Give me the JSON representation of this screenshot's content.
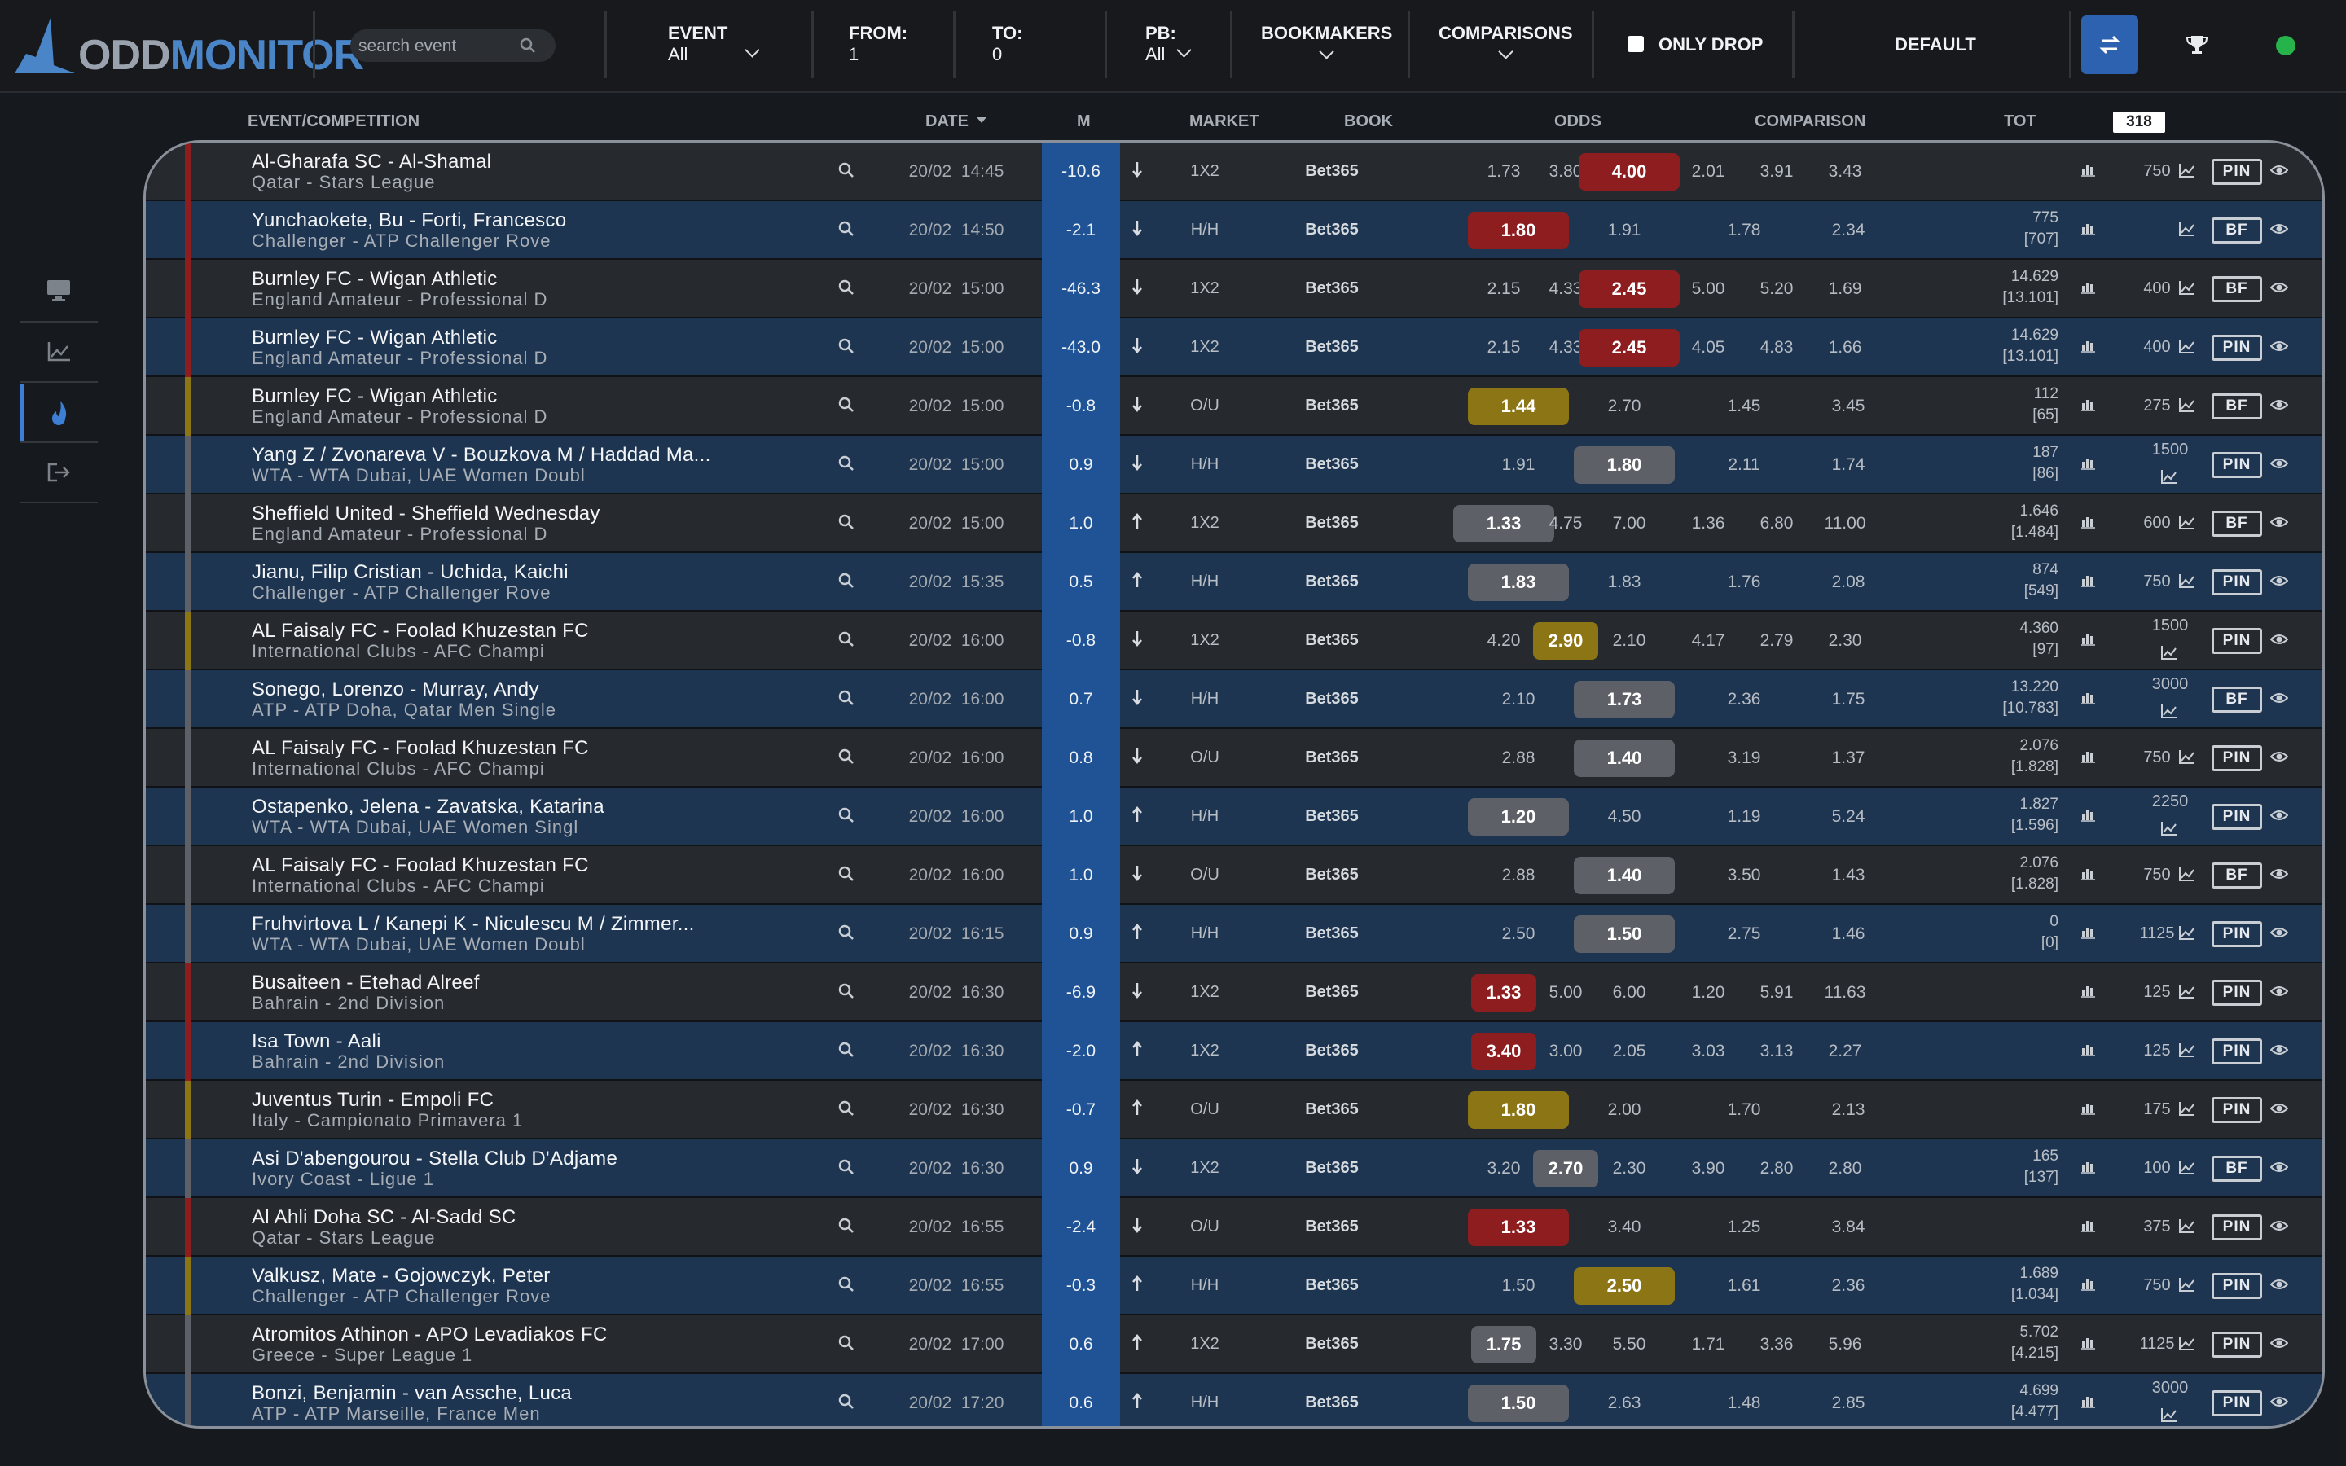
{
  "app": {
    "logo_odd": "ODD",
    "logo_monitor": "MONITOR",
    "search_placeholder": "search event"
  },
  "filters": {
    "event_label": "EVENT",
    "event_value": "All",
    "from_label": "FROM:",
    "from_value": "1",
    "to_label": "TO:",
    "to_value": "0",
    "pb_label": "PB:",
    "pb_value": "All",
    "bookmakers_label": "BOOKMAKERS",
    "comparisons_label": "COMPARISONS",
    "only_drop_label": "ONLY DROP",
    "default_label": "DEFAULT"
  },
  "colors": {
    "accent": "#2d62b0",
    "red": "#8e1d1f",
    "yellow": "#8c7514",
    "gray": "#5d6066",
    "status": "#27b34b"
  },
  "columns": {
    "event": "EVENT/COMPETITION",
    "date": "DATE",
    "m": "M",
    "market": "MARKET",
    "book": "BOOK",
    "odds": "ODDS",
    "comparison": "COMPARISON",
    "tot": "TOT",
    "count": "318"
  },
  "rows": [
    {
      "stripe": "red",
      "event": "Al-Gharafa SC - Al-Shamal",
      "comp": "Qatar - Stars League",
      "date": "20/02",
      "time": "14:45",
      "m": "-10.6",
      "dir": "down",
      "market": "1X2",
      "book": "Bet365",
      "odds": [
        "1.73",
        "3.80",
        "4.00"
      ],
      "hi": 2,
      "hic": "red",
      "cmp": [
        "2.01",
        "3.91",
        "3.43"
      ],
      "tot1": "",
      "tot2": "",
      "vol": "750",
      "tag": "PIN"
    },
    {
      "stripe": "red",
      "event": "Yunchaokete, Bu - Forti, Francesco",
      "comp": "Challenger - ATP Challenger Rove",
      "date": "20/02",
      "time": "14:50",
      "m": "-2.1",
      "dir": "down",
      "market": "H/H",
      "book": "Bet365",
      "odds": [
        "1.80",
        "1.91"
      ],
      "hi": 0,
      "hic": "red",
      "cmp": [
        "1.78",
        "2.34"
      ],
      "tot1": "775",
      "tot2": "[707]",
      "vol": "",
      "tag": "BF"
    },
    {
      "stripe": "red",
      "event": "Burnley FC - Wigan Athletic",
      "comp": "England Amateur - Professional D",
      "date": "20/02",
      "time": "15:00",
      "m": "-46.3",
      "dir": "down",
      "market": "1X2",
      "book": "Bet365",
      "odds": [
        "2.15",
        "4.33",
        "2.45"
      ],
      "hi": 2,
      "hic": "red",
      "cmp": [
        "5.00",
        "5.20",
        "1.69"
      ],
      "tot1": "14.629",
      "tot2": "[13.101]",
      "vol": "400",
      "tag": "BF"
    },
    {
      "stripe": "red",
      "event": "Burnley FC - Wigan Athletic",
      "comp": "England Amateur - Professional D",
      "date": "20/02",
      "time": "15:00",
      "m": "-43.0",
      "dir": "down",
      "market": "1X2",
      "book": "Bet365",
      "odds": [
        "2.15",
        "4.33",
        "2.45"
      ],
      "hi": 2,
      "hic": "red",
      "cmp": [
        "4.05",
        "4.83",
        "1.66"
      ],
      "tot1": "14.629",
      "tot2": "[13.101]",
      "vol": "400",
      "tag": "PIN"
    },
    {
      "stripe": "yellow",
      "event": "Burnley FC - Wigan Athletic",
      "comp": "England Amateur - Professional D",
      "date": "20/02",
      "time": "15:00",
      "m": "-0.8",
      "dir": "down",
      "market": "O/U",
      "book": "Bet365",
      "odds": [
        "1.44",
        "2.70"
      ],
      "hi": 0,
      "hic": "yellow",
      "cmp": [
        "1.45",
        "3.45"
      ],
      "tot1": "112",
      "tot2": "[65]",
      "vol": "275",
      "tag": "BF"
    },
    {
      "stripe": "gray",
      "event": "Yang Z / Zvonareva V - Bouzkova M / Haddad Ma...",
      "comp": "WTA - WTA Dubai, UAE Women Doubl",
      "date": "20/02",
      "time": "15:00",
      "m": "0.9",
      "dir": "down",
      "market": "H/H",
      "book": "Bet365",
      "odds": [
        "1.91",
        "1.80"
      ],
      "hi": 1,
      "hic": "gray",
      "cmp": [
        "2.11",
        "1.74"
      ],
      "tot1": "187",
      "tot2": "[86]",
      "vol": "1500",
      "stack": true,
      "tag": "PIN"
    },
    {
      "stripe": "gray",
      "event": "Sheffield United - Sheffield Wednesday",
      "comp": "England Amateur - Professional D",
      "date": "20/02",
      "time": "15:00",
      "m": "1.0",
      "dir": "up",
      "market": "1X2",
      "book": "Bet365",
      "odds": [
        "1.33",
        "4.75",
        "7.00"
      ],
      "hi": 0,
      "hic": "gray",
      "cmp": [
        "1.36",
        "6.80",
        "11.00"
      ],
      "tot1": "1.646",
      "tot2": "[1.484]",
      "vol": "600",
      "tag": "BF"
    },
    {
      "stripe": "gray",
      "event": "Jianu, Filip Cristian - Uchida, Kaichi",
      "comp": "Challenger - ATP Challenger Rove",
      "date": "20/02",
      "time": "15:35",
      "m": "0.5",
      "dir": "up",
      "market": "H/H",
      "book": "Bet365",
      "odds": [
        "1.83",
        "1.83"
      ],
      "hi": 0,
      "hic": "gray",
      "cmp": [
        "1.76",
        "2.08"
      ],
      "tot1": "874",
      "tot2": "[549]",
      "vol": "750",
      "tag": "PIN"
    },
    {
      "stripe": "yellow",
      "event": "AL Faisaly FC - Foolad Khuzestan FC",
      "comp": "International Clubs - AFC Champi",
      "date": "20/02",
      "time": "16:00",
      "m": "-0.8",
      "dir": "down",
      "market": "1X2",
      "book": "Bet365",
      "odds": [
        "4.20",
        "2.90",
        "2.10"
      ],
      "hi": 1,
      "hic": "yellow",
      "small": true,
      "cmp": [
        "4.17",
        "2.79",
        "2.30"
      ],
      "tot1": "4.360",
      "tot2": "[97]",
      "vol": "1500",
      "stack": true,
      "tag": "PIN"
    },
    {
      "stripe": "gray",
      "event": "Sonego, Lorenzo - Murray, Andy",
      "comp": "ATP - ATP Doha, Qatar Men Single",
      "date": "20/02",
      "time": "16:00",
      "m": "0.7",
      "dir": "down",
      "market": "H/H",
      "book": "Bet365",
      "odds": [
        "2.10",
        "1.73"
      ],
      "hi": 1,
      "hic": "gray",
      "cmp": [
        "2.36",
        "1.75"
      ],
      "tot1": "13.220",
      "tot2": "[10.783]",
      "vol": "3000",
      "stack": true,
      "tag": "BF"
    },
    {
      "stripe": "gray",
      "event": "AL Faisaly FC - Foolad Khuzestan FC",
      "comp": "International Clubs - AFC Champi",
      "date": "20/02",
      "time": "16:00",
      "m": "0.8",
      "dir": "down",
      "market": "O/U",
      "book": "Bet365",
      "odds": [
        "2.88",
        "1.40"
      ],
      "hi": 1,
      "hic": "gray",
      "cmp": [
        "3.19",
        "1.37"
      ],
      "tot1": "2.076",
      "tot2": "[1.828]",
      "vol": "750",
      "tag": "PIN"
    },
    {
      "stripe": "gray",
      "event": "Ostapenko, Jelena - Zavatska, Katarina",
      "comp": "WTA - WTA Dubai, UAE Women Singl",
      "date": "20/02",
      "time": "16:00",
      "m": "1.0",
      "dir": "up",
      "market": "H/H",
      "book": "Bet365",
      "odds": [
        "1.20",
        "4.50"
      ],
      "hi": 0,
      "hic": "gray",
      "cmp": [
        "1.19",
        "5.24"
      ],
      "tot1": "1.827",
      "tot2": "[1.596]",
      "vol": "2250",
      "stack": true,
      "tag": "PIN"
    },
    {
      "stripe": "gray",
      "event": "AL Faisaly FC - Foolad Khuzestan FC",
      "comp": "International Clubs - AFC Champi",
      "date": "20/02",
      "time": "16:00",
      "m": "1.0",
      "dir": "down",
      "market": "O/U",
      "book": "Bet365",
      "odds": [
        "2.88",
        "1.40"
      ],
      "hi": 1,
      "hic": "gray",
      "cmp": [
        "3.50",
        "1.43"
      ],
      "tot1": "2.076",
      "tot2": "[1.828]",
      "vol": "750",
      "tag": "BF"
    },
    {
      "stripe": "gray",
      "event": "Fruhvirtova L / Kanepi K - Niculescu M / Zimmer...",
      "comp": "WTA - WTA Dubai, UAE Women Doubl",
      "date": "20/02",
      "time": "16:15",
      "m": "0.9",
      "dir": "up",
      "market": "H/H",
      "book": "Bet365",
      "odds": [
        "2.50",
        "1.50"
      ],
      "hi": 1,
      "hic": "gray",
      "cmp": [
        "2.75",
        "1.46"
      ],
      "tot1": "0",
      "tot2": "[0]",
      "vol": "1125",
      "tag": "PIN"
    },
    {
      "stripe": "red",
      "event": "Busaiteen - Etehad Alreef",
      "comp": "Bahrain - 2nd Division",
      "date": "20/02",
      "time": "16:30",
      "m": "-6.9",
      "dir": "down",
      "market": "1X2",
      "book": "Bet365",
      "odds": [
        "1.33",
        "5.00",
        "6.00"
      ],
      "hi": 0,
      "hic": "red",
      "small": true,
      "cmp": [
        "1.20",
        "5.91",
        "11.63"
      ],
      "tot1": "",
      "tot2": "",
      "vol": "125",
      "tag": "PIN"
    },
    {
      "stripe": "red",
      "event": "Isa Town - Aali",
      "comp": "Bahrain - 2nd Division",
      "date": "20/02",
      "time": "16:30",
      "m": "-2.0",
      "dir": "up",
      "market": "1X2",
      "book": "Bet365",
      "odds": [
        "3.40",
        "3.00",
        "2.05"
      ],
      "hi": 0,
      "hic": "red",
      "small": true,
      "cmp": [
        "3.03",
        "3.13",
        "2.27"
      ],
      "tot1": "",
      "tot2": "",
      "vol": "125",
      "tag": "PIN"
    },
    {
      "stripe": "yellow",
      "event": "Juventus Turin - Empoli FC",
      "comp": "Italy - Campionato Primavera 1",
      "date": "20/02",
      "time": "16:30",
      "m": "-0.7",
      "dir": "up",
      "market": "O/U",
      "book": "Bet365",
      "odds": [
        "1.80",
        "2.00"
      ],
      "hi": 0,
      "hic": "yellow",
      "cmp": [
        "1.70",
        "2.13"
      ],
      "tot1": "",
      "tot2": "",
      "vol": "175",
      "tag": "PIN"
    },
    {
      "stripe": "gray",
      "event": "Asi D'abengourou - Stella Club D'Adjame",
      "comp": "Ivory Coast - Ligue 1",
      "date": "20/02",
      "time": "16:30",
      "m": "0.9",
      "dir": "down",
      "market": "1X2",
      "book": "Bet365",
      "odds": [
        "3.20",
        "2.70",
        "2.30"
      ],
      "hi": 1,
      "hic": "gray",
      "small": true,
      "cmp": [
        "3.90",
        "2.80",
        "2.80"
      ],
      "tot1": "165",
      "tot2": "[137]",
      "vol": "100",
      "tag": "BF"
    },
    {
      "stripe": "red",
      "event": "Al Ahli Doha SC - Al-Sadd SC",
      "comp": "Qatar - Stars League",
      "date": "20/02",
      "time": "16:55",
      "m": "-2.4",
      "dir": "down",
      "market": "O/U",
      "book": "Bet365",
      "odds": [
        "1.33",
        "3.40"
      ],
      "hi": 0,
      "hic": "red",
      "cmp": [
        "1.25",
        "3.84"
      ],
      "tot1": "",
      "tot2": "",
      "vol": "375",
      "tag": "PIN"
    },
    {
      "stripe": "yellow",
      "event": "Valkusz, Mate - Gojowczyk, Peter",
      "comp": "Challenger - ATP Challenger Rove",
      "date": "20/02",
      "time": "16:55",
      "m": "-0.3",
      "dir": "up",
      "market": "H/H",
      "book": "Bet365",
      "odds": [
        "1.50",
        "2.50"
      ],
      "hi": 1,
      "hic": "yellow",
      "cmp": [
        "1.61",
        "2.36"
      ],
      "tot1": "1.689",
      "tot2": "[1.034]",
      "vol": "750",
      "tag": "PIN"
    },
    {
      "stripe": "gray",
      "event": "Atromitos Athinon - APO Levadiakos FC",
      "comp": "Greece - Super League 1",
      "date": "20/02",
      "time": "17:00",
      "m": "0.6",
      "dir": "up",
      "market": "1X2",
      "book": "Bet365",
      "odds": [
        "1.75",
        "3.30",
        "5.50"
      ],
      "hi": 0,
      "hic": "gray",
      "small": true,
      "cmp": [
        "1.71",
        "3.36",
        "5.96"
      ],
      "tot1": "5.702",
      "tot2": "[4.215]",
      "vol": "1125",
      "tag": "PIN"
    },
    {
      "stripe": "gray",
      "event": "Bonzi, Benjamin - van Assche, Luca",
      "comp": "ATP - ATP Marseille, France Men",
      "date": "20/02",
      "time": "17:20",
      "m": "0.6",
      "dir": "up",
      "market": "H/H",
      "book": "Bet365",
      "odds": [
        "1.50",
        "2.63"
      ],
      "hi": 0,
      "hic": "gray",
      "cmp": [
        "1.48",
        "2.85"
      ],
      "tot1": "4.699",
      "tot2": "[4.477]",
      "vol": "3000",
      "stack": true,
      "tag": "PIN"
    }
  ]
}
